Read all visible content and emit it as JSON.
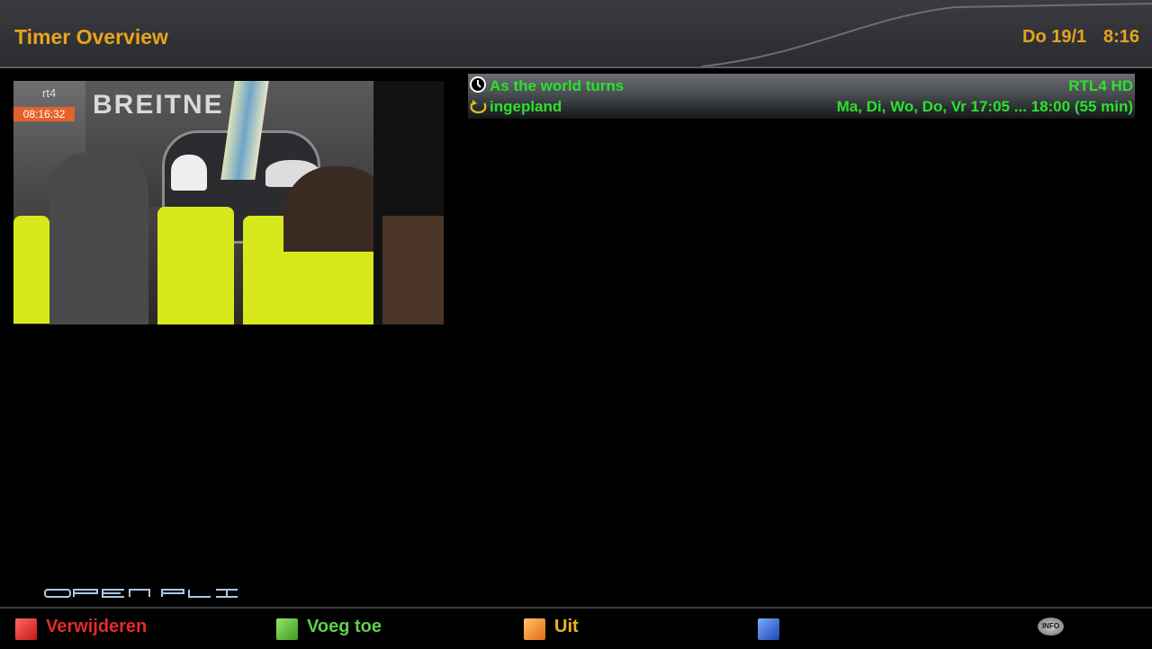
{
  "header": {
    "title": "Timer Overview",
    "date": "Do 19/1",
    "time": "8:16"
  },
  "preview": {
    "channel_logo": "rt4",
    "timestamp": "08:16:32",
    "sign_text": "BREITNE"
  },
  "timers": [
    {
      "name": "As the world turns",
      "channel": "RTL4 HD",
      "status": "ingepland",
      "schedule": "Ma, Di, Wo, Do, Vr 17:05 ... 18:00 (55 min)",
      "type_icon": "clock-icon",
      "repeat_icon": "repeat-icon"
    }
  ],
  "logo_text": "OPEN PLI",
  "footer": {
    "red_label": "Verwijderen",
    "green_label": "Voeg toe",
    "yellow_label": "Uit",
    "blue_label": "",
    "info_label": "INFO"
  },
  "colors": {
    "accent": "#e7a41c",
    "timer_text": "#29e32b",
    "red": "#e52a2a",
    "green": "#5fcf4c",
    "yellow": "#f0b21e",
    "blue": "#2b63d8"
  }
}
